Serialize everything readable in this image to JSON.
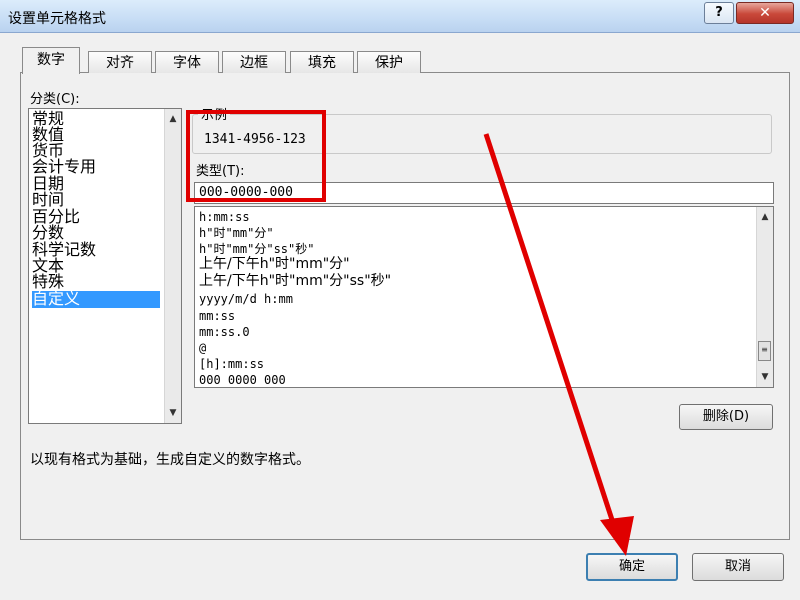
{
  "dialog": {
    "title": "设置单元格格式",
    "help_label": "?",
    "close_label": "✕"
  },
  "tabs": [
    {
      "label": "数字",
      "active": true
    },
    {
      "label": "对齐"
    },
    {
      "label": "字体"
    },
    {
      "label": "边框"
    },
    {
      "label": "填充"
    },
    {
      "label": "保护"
    }
  ],
  "category": {
    "label": "分类(C):",
    "items": [
      "常规",
      "数值",
      "货币",
      "会计专用",
      "日期",
      "时间",
      "百分比",
      "分数",
      "科学记数",
      "文本",
      "特殊",
      "自定义"
    ],
    "selected": "自定义"
  },
  "sample": {
    "label": "示例",
    "value": "1341-4956-123"
  },
  "type": {
    "label": "类型(T):",
    "value": "000-0000-000"
  },
  "formats": [
    "h:mm:ss",
    "h\"时\"mm\"分\"",
    "h\"时\"mm\"分\"ss\"秒\"",
    "上午/下午h\"时\"mm\"分\"",
    "上午/下午h\"时\"mm\"分\"ss\"秒\"",
    "yyyy/m/d h:mm",
    "mm:ss",
    "mm:ss.0",
    "@",
    "[h]:mm:ss",
    "000 0000 000"
  ],
  "delete_button": "删除(D)",
  "description": "以现有格式为基础，生成自定义的数字格式。",
  "ok_button": "确定",
  "cancel_button": "取消",
  "colors": {
    "annotation": "#e00000",
    "selection": "#3399ff"
  }
}
